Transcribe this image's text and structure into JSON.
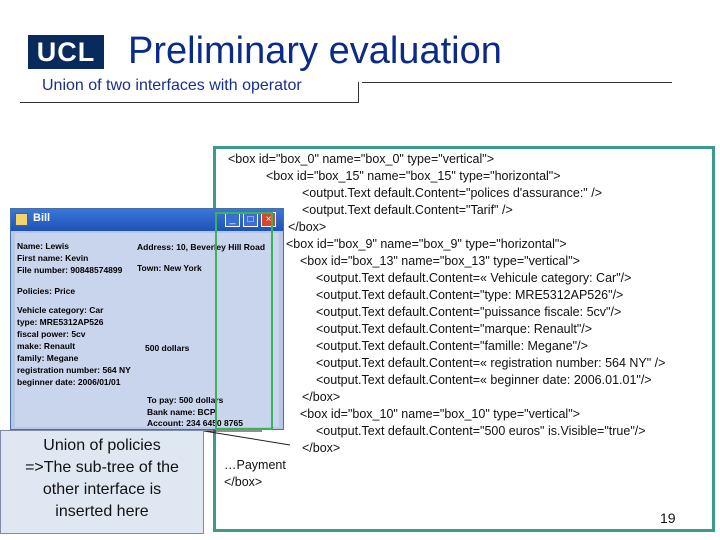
{
  "header": {
    "logo_text": "UCL",
    "title": "Preliminary evaluation",
    "subtitle": "Union of two interfaces with operator"
  },
  "code_lines": [
    "<box id=\"box_0\" name=\"box_0\" type=\"vertical\">",
    "<box id=\"box_15\" name=\"box_15\" type=\"horizontal\">",
    "<output.Text default.Content=\"polices d'assurance:\" />",
    "<output.Text default.Content=\"Tarif\" />",
    "</box>",
    "<box id=\"box_9\" name=\"box_9\" type=\"horizontal\">",
    "<box id=\"box_13\" name=\"box_13\" type=\"vertical\">",
    "<output.Text default.Content=« Vehicule category: Car\"/>",
    "<output.Text default.Content=\"type: MRE5312AP526\"/>",
    "<output.Text default.Content=\"puissance fiscale: 5cv\"/>",
    "<output.Text default.Content=\"marque: Renault\"/>",
    "<output.Text default.Content=\"famille: Megane\"/>",
    "<output.Text default.Content=« registration number: 564 NY\" />",
    "<output.Text default.Content=« beginner date: 2006.01.01\"/>",
    "</box>",
    "<box id=\"box_10\" name=\"box_10\" type=\"vertical\">",
    "<output.Text default.Content=\"500 euros\" is.Visible=\"true\"/>",
    "</box>",
    "…Payment",
    "</box>"
  ],
  "window": {
    "title": "Bill",
    "labels": {
      "name": "Name: Lewis",
      "first_name": "First name: Kevin",
      "file_number": "File number: 90848574899",
      "address": "Address:  10, Beverley Hill Road",
      "town": "Town: New York",
      "policies": "Policies: Price",
      "vehicle_category": "Vehicle category: Car",
      "type": "type: MRE5312AP526",
      "fiscal_power": "fiscal power: 5cv",
      "make": "make: Renault",
      "family": "family: Megane",
      "registration": "registration number: 564 NY",
      "beginner_date": "beginner date: 2006/01/01",
      "amount": "500 dollars",
      "to_pay": "To pay: 500 dollars",
      "bank_name": "Bank name: BCP",
      "account": "Account: 234 6450 8765"
    }
  },
  "callout": {
    "line1": "Union of policies",
    "line2": "=>The sub-tree of the",
    "line3": "other interface is",
    "line4": "inserted here"
  },
  "page_number": "19",
  "colors": {
    "title": "#0b2b88",
    "logo_bg": "#082a5c",
    "code_frame": "#3c9a8f",
    "selection": "#39b25a"
  }
}
